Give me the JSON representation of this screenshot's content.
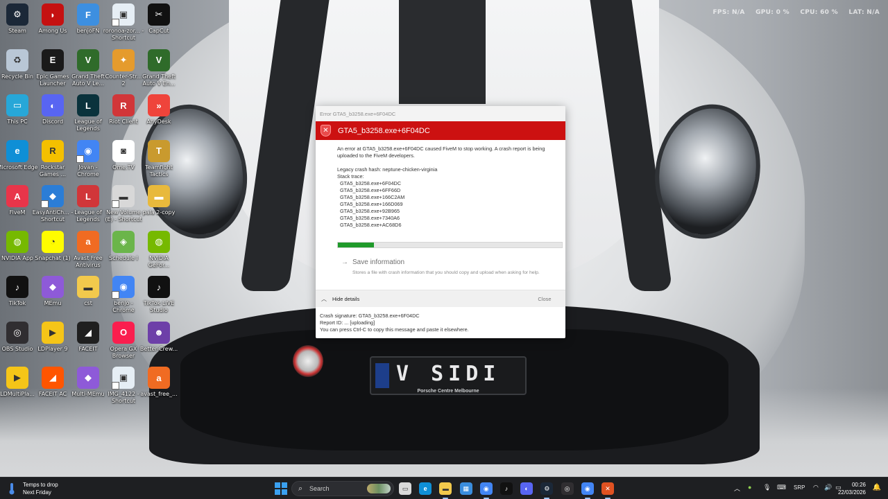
{
  "overlay_stats": [
    "FPS: N/A",
    "GPU: 0 %",
    "CPU: 60 %",
    "LAT: N/A"
  ],
  "desktop_icons": [
    {
      "label": "Steam",
      "icon": "steam-icon",
      "color": "#1b2838"
    },
    {
      "label": "Among Us",
      "icon": "among-us-icon",
      "color": "#c51111"
    },
    {
      "label": "benjoFN",
      "icon": "file-icon",
      "color": "#3d8fe0"
    },
    {
      "label": "roronoa-zor... - Shortcut",
      "icon": "image-file-icon",
      "color": "#e6eef5"
    },
    {
      "label": "CapCut",
      "icon": "capcut-icon",
      "color": "#111111"
    },
    {
      "label": "Recycle Bin",
      "icon": "recycle-bin-icon",
      "color": "#b9c7d6"
    },
    {
      "label": "Epic Games Launcher",
      "icon": "epic-games-icon",
      "color": "#1a1a1a"
    },
    {
      "label": "Grand Theft Auto V Le...",
      "icon": "gta-v-icon",
      "color": "#2f6b2a"
    },
    {
      "label": "Counter-Str... 2",
      "icon": "counter-strike-icon",
      "color": "#e59b2d"
    },
    {
      "label": "Grand Theft Auto V En...",
      "icon": "gta-v-icon",
      "color": "#2f6b2a"
    },
    {
      "label": "This PC",
      "icon": "monitor-icon",
      "color": "#27a7d8"
    },
    {
      "label": "Discord",
      "icon": "discord-icon",
      "color": "#5865f2"
    },
    {
      "label": "League of Legends",
      "icon": "league-of-legends-icon",
      "color": "#0a323c"
    },
    {
      "label": "Riot Client",
      "icon": "riot-client-icon",
      "color": "#d13639"
    },
    {
      "label": "AnyDesk",
      "icon": "anydesk-icon",
      "color": "#ef443b"
    },
    {
      "label": "Microsoft Edge",
      "icon": "edge-icon",
      "color": "#0f8fd6"
    },
    {
      "label": "Rockstar Games ...",
      "icon": "rockstar-icon",
      "color": "#f4c000"
    },
    {
      "label": "Jovan - Chrome",
      "icon": "chrome-icon",
      "color": "#4285f4"
    },
    {
      "label": "Ome.TV",
      "icon": "ometv-icon",
      "color": "#ffffff"
    },
    {
      "label": "Teamfight Tactics",
      "icon": "teamfight-tactics-icon",
      "color": "#c99a2e"
    },
    {
      "label": "FiveM",
      "icon": "fivem-icon",
      "color": "#e8354a"
    },
    {
      "label": "EasyAntiCh... - Shortcut",
      "icon": "easy-anticheat-icon",
      "color": "#2b7dd6"
    },
    {
      "label": "League of Legends",
      "icon": "league-of-legends-icon",
      "color": "#d13639"
    },
    {
      "label": "New Volume (E) - Shortcut",
      "icon": "drive-icon",
      "color": "#d8d8d8"
    },
    {
      "label": "pala 2-copy",
      "icon": "folder-icon",
      "color": "#e8b93c"
    },
    {
      "label": "NVIDIA App",
      "icon": "nvidia-icon",
      "color": "#76b900"
    },
    {
      "label": "Snapchat (1)",
      "icon": "snapchat-icon",
      "color": "#fffc00"
    },
    {
      "label": "Avast Free Antivirus",
      "icon": "avast-icon",
      "color": "#f06b22"
    },
    {
      "label": "Schedule I",
      "icon": "schedule-one-icon",
      "color": "#6bb54a"
    },
    {
      "label": "NVIDIA GeFor...",
      "icon": "nvidia-icon",
      "color": "#76b900"
    },
    {
      "label": "TikTok",
      "icon": "tiktok-icon",
      "color": "#111111"
    },
    {
      "label": "MEmu",
      "icon": "memu-icon",
      "color": "#8e5ad8"
    },
    {
      "label": "cst",
      "icon": "folder-icon",
      "color": "#f2c94c"
    },
    {
      "label": "benjo - Chrome",
      "icon": "chrome-icon",
      "color": "#4285f4"
    },
    {
      "label": "TikTok LIVE Studio",
      "icon": "tiktok-live-icon",
      "color": "#111111"
    },
    {
      "label": "OBS Studio",
      "icon": "obs-icon",
      "color": "#302e31"
    },
    {
      "label": "LDPlayer 9",
      "icon": "ldplayer-icon",
      "color": "#f5c518"
    },
    {
      "label": "FACEIT",
      "icon": "faceit-icon",
      "color": "#1f1f1f"
    },
    {
      "label": "Opera GX Browser",
      "icon": "opera-gx-icon",
      "color": "#fa1e4e"
    },
    {
      "label": "Better-Crew...",
      "icon": "better-crewlink-icon",
      "color": "#6d3fa8"
    },
    {
      "label": "LDMultiPla...",
      "icon": "ldmultiplayer-icon",
      "color": "#f5c518"
    },
    {
      "label": "FACEIT AC",
      "icon": "faceit-ac-icon",
      "color": "#ff5500"
    },
    {
      "label": "Multi-MEmu",
      "icon": "multi-memu-icon",
      "color": "#8e5ad8"
    },
    {
      "label": "IMG_4122 - Shortcut",
      "icon": "image-file-icon",
      "color": "#e6eef5"
    },
    {
      "label": "avast_free_...",
      "icon": "avast-icon",
      "color": "#f06b22"
    }
  ],
  "plate": {
    "text": "V  SIDI",
    "sub": "Porsche Centre Melbourne"
  },
  "dialog": {
    "window_title": "Error GTA5_b3258.exe+6F04DC",
    "header_title": "GTA5_b3258.exe+6F04DC",
    "message": "An error at GTA5_b3258.exe+6F04DC caused FiveM to stop working. A crash report is being uploaded to the FiveM developers.",
    "legacy_hash": "Legacy crash hash: neptune-chicken-virginia",
    "stack_label": "Stack trace:",
    "stack": [
      "GTA5_b3258.exe+6F04DC",
      "GTA5_b3258.exe+6FF66D",
      "GTA5_b3258.exe+166C2AM",
      "GTA5_b3258.exe+166D069",
      "GTA5_b3258.exe+92B965",
      "GTA5_b3258.exe+7340A6",
      "GTA5_b3258.exe+AC68D6"
    ],
    "progress": 0.16,
    "progress_color": "#1f9a2a",
    "save_title": "Save information",
    "save_desc": "Stores a file with crash information that you should copy and upload when asking for help.",
    "hide_details": "Hide details",
    "close_label": "Close",
    "details": [
      "Crash signature: GTA5_b3258.exe+6F04DC",
      "Report ID: ... [uploading]",
      "You can press Ctrl-C to copy this message and paste it elsewhere."
    ]
  },
  "taskbar": {
    "weather_title": "Temps to drop",
    "weather_sub": "Next Friday",
    "search_placeholder": "Search",
    "language": "SRP",
    "time": "00:26",
    "date": "22/03/2026",
    "apps": [
      {
        "name": "task-view-icon",
        "color": "#d9d9d9",
        "glyph": "▭"
      },
      {
        "name": "edge-icon",
        "color": "#0f8fd6",
        "glyph": "e"
      },
      {
        "name": "file-explorer-icon",
        "color": "#f2c94c",
        "glyph": "▬"
      },
      {
        "name": "microsoft-store-icon",
        "color": "#3a8dde",
        "glyph": "▦"
      },
      {
        "name": "chrome-icon",
        "color": "#4285f4",
        "glyph": "◉"
      },
      {
        "name": "tiktok-icon",
        "color": "#111111",
        "glyph": "♪"
      },
      {
        "name": "discord-icon",
        "color": "#5865f2",
        "glyph": "◐"
      },
      {
        "name": "steam-icon",
        "color": "#1b2838",
        "glyph": "⚙"
      },
      {
        "name": "obs-icon",
        "color": "#302e31",
        "glyph": "◎"
      },
      {
        "name": "chrome-profile-icon",
        "color": "#4285f4",
        "glyph": "◉"
      },
      {
        "name": "fivem-error-icon",
        "color": "#e05222",
        "glyph": "✕"
      }
    ]
  }
}
